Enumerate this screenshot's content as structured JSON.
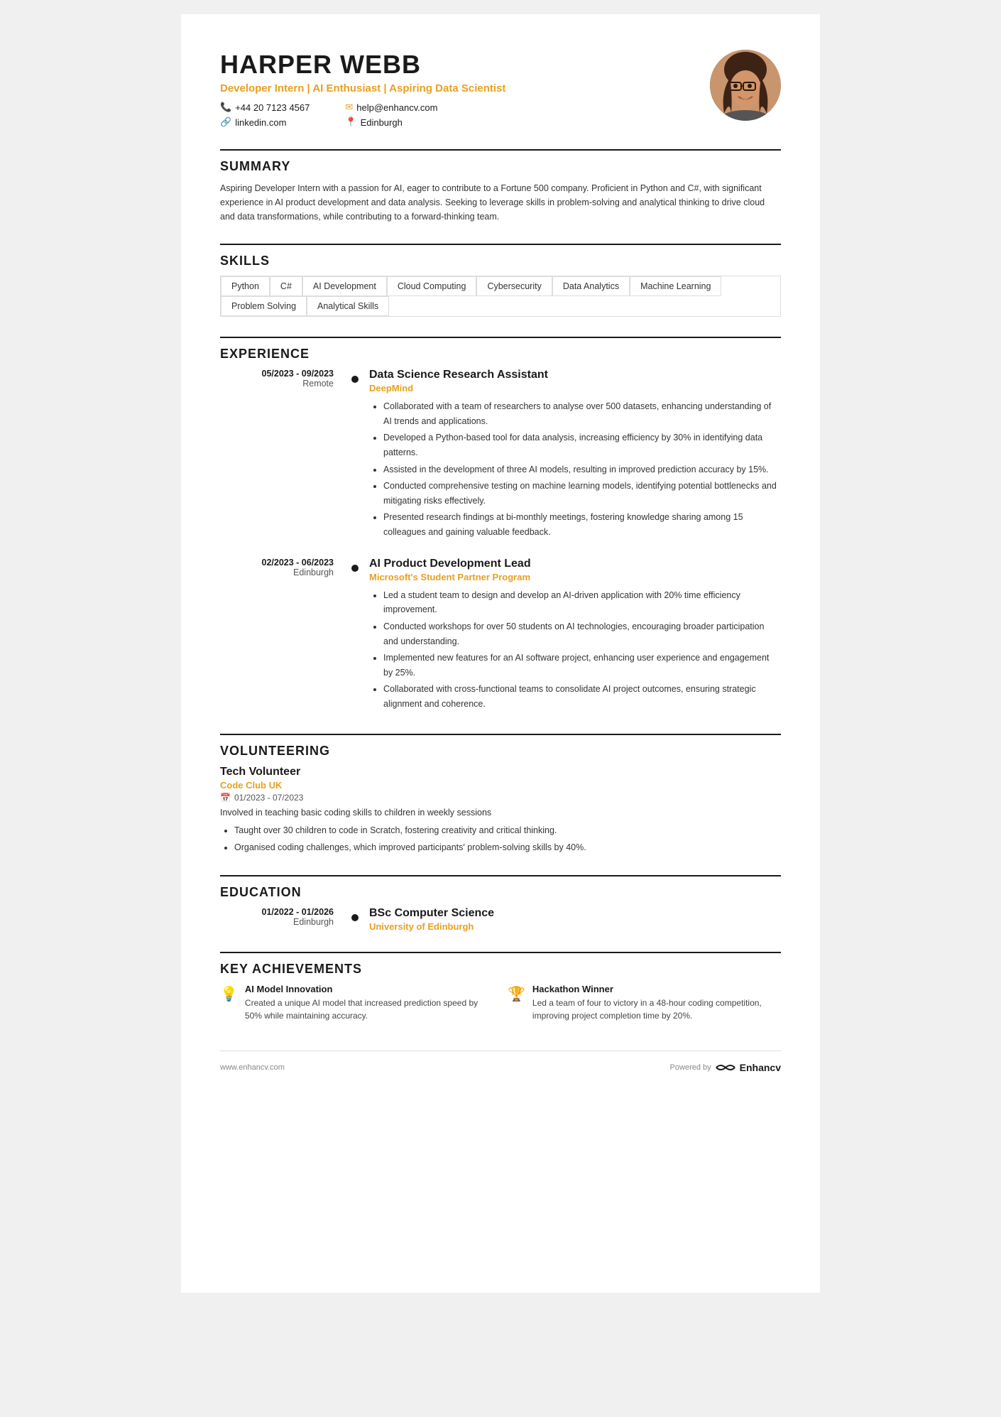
{
  "header": {
    "name": "HARPER WEBB",
    "title": "Developer Intern | AI Enthusiast | Aspiring Data Scientist",
    "phone": "+44 20 7123 4567",
    "email": "help@enhancv.com",
    "linkedin": "linkedin.com",
    "location": "Edinburgh"
  },
  "summary": {
    "title": "SUMMARY",
    "text": "Aspiring Developer Intern with a passion for AI, eager to contribute to a Fortune 500 company. Proficient in Python and C#, with significant experience in AI product development and data analysis. Seeking to leverage skills in problem-solving and analytical thinking to drive cloud and data transformations, while contributing to a forward-thinking team."
  },
  "skills": {
    "title": "SKILLS",
    "tags": [
      "Python",
      "C#",
      "AI Development",
      "Cloud Computing",
      "Cybersecurity",
      "Data Analytics",
      "Machine Learning",
      "Problem Solving",
      "Analytical Skills"
    ]
  },
  "experience": {
    "title": "EXPERIENCE",
    "entries": [
      {
        "dates": "05/2023 - 09/2023",
        "location": "Remote",
        "title": "Data Science Research Assistant",
        "company": "DeepMind",
        "bullets": [
          "Collaborated with a team of researchers to analyse over 500 datasets, enhancing understanding of AI trends and applications.",
          "Developed a Python-based tool for data analysis, increasing efficiency by 30% in identifying data patterns.",
          "Assisted in the development of three AI models, resulting in improved prediction accuracy by 15%.",
          "Conducted comprehensive testing on machine learning models, identifying potential bottlenecks and mitigating risks effectively.",
          "Presented research findings at bi-monthly meetings, fostering knowledge sharing among 15 colleagues and gaining valuable feedback."
        ]
      },
      {
        "dates": "02/2023 - 06/2023",
        "location": "Edinburgh",
        "title": "AI Product Development Lead",
        "company": "Microsoft's Student Partner Program",
        "bullets": [
          "Led a student team to design and develop an AI-driven application with 20% time efficiency improvement.",
          "Conducted workshops for over 50 students on AI technologies, encouraging broader participation and understanding.",
          "Implemented new features for an AI software project, enhancing user experience and engagement by 25%.",
          "Collaborated with cross-functional teams to consolidate AI project outcomes, ensuring strategic alignment and coherence."
        ]
      }
    ]
  },
  "volunteering": {
    "title": "VOLUNTEERING",
    "entries": [
      {
        "role": "Tech Volunteer",
        "org": "Code Club UK",
        "dates": "01/2023 - 07/2023",
        "description": "Involved in teaching basic coding skills to children in weekly sessions",
        "bullets": [
          "Taught over 30 children to code in Scratch, fostering creativity and critical thinking.",
          "Organised coding challenges, which improved participants' problem-solving skills by 40%."
        ]
      }
    ]
  },
  "education": {
    "title": "EDUCATION",
    "entries": [
      {
        "dates": "01/2022 - 01/2026",
        "location": "Edinburgh",
        "degree": "BSc Computer Science",
        "school": "University of Edinburgh"
      }
    ]
  },
  "achievements": {
    "title": "KEY ACHIEVEMENTS",
    "entries": [
      {
        "icon": "💡",
        "title": "AI Model Innovation",
        "description": "Created a unique AI model that increased prediction speed by 50% while maintaining accuracy."
      },
      {
        "icon": "🏆",
        "title": "Hackathon Winner",
        "description": "Led a team of four to victory in a 48-hour coding competition, improving project completion time by 20%."
      }
    ]
  },
  "footer": {
    "url": "www.enhancv.com",
    "powered_by": "Powered by",
    "brand": "Enhancv"
  }
}
